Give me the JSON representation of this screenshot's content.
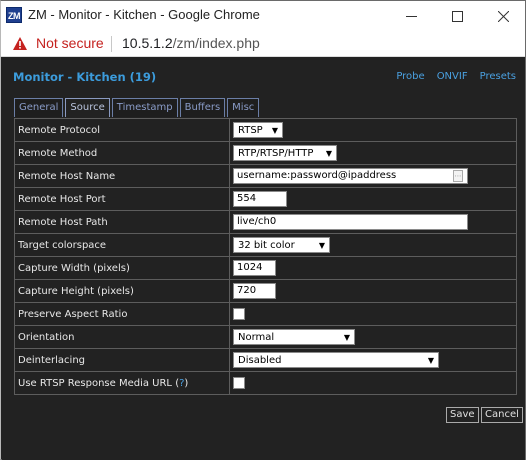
{
  "window": {
    "app_icon_text": "ZM",
    "title": "ZM - Monitor - Kitchen - Google Chrome"
  },
  "address_bar": {
    "security_label": "Not secure",
    "url_host": "10.5.1.2",
    "url_path": "/zm/index.php"
  },
  "page": {
    "title": "Monitor - Kitchen (19)",
    "links": {
      "probe": "Probe",
      "onvif": "ONVIF",
      "presets": "Presets"
    }
  },
  "tabs": [
    "General",
    "Source",
    "Timestamp",
    "Buffers",
    "Misc"
  ],
  "active_tab": "Source",
  "fields": {
    "remote_protocol": {
      "label": "Remote Protocol",
      "value": "RTSP"
    },
    "remote_method": {
      "label": "Remote Method",
      "value": "RTP/RTSP/HTTP"
    },
    "remote_host_name": {
      "label": "Remote Host Name",
      "value": "username:password@ipaddress"
    },
    "remote_host_port": {
      "label": "Remote Host Port",
      "value": "554"
    },
    "remote_host_path": {
      "label": "Remote Host Path",
      "value": "live/ch0"
    },
    "target_colorspace": {
      "label": "Target colorspace",
      "value": "32 bit color"
    },
    "capture_width": {
      "label": "Capture Width (pixels)",
      "value": "1024"
    },
    "capture_height": {
      "label": "Capture Height (pixels)",
      "value": "720"
    },
    "preserve_aspect": {
      "label": "Preserve Aspect Ratio",
      "checked": false
    },
    "orientation": {
      "label": "Orientation",
      "value": "Normal"
    },
    "deinterlacing": {
      "label": "Deinterlacing",
      "value": "Disabled"
    },
    "rtsp_media_url": {
      "label": "Use RTSP Response Media URL",
      "help": "?",
      "checked": false
    }
  },
  "buttons": {
    "save": "Save",
    "cancel": "Cancel"
  },
  "colors": {
    "page_bg": "#222222",
    "title_blue": "#3c9cdc",
    "link_blue": "#4aa0e0",
    "not_secure_red": "#c5221f"
  }
}
